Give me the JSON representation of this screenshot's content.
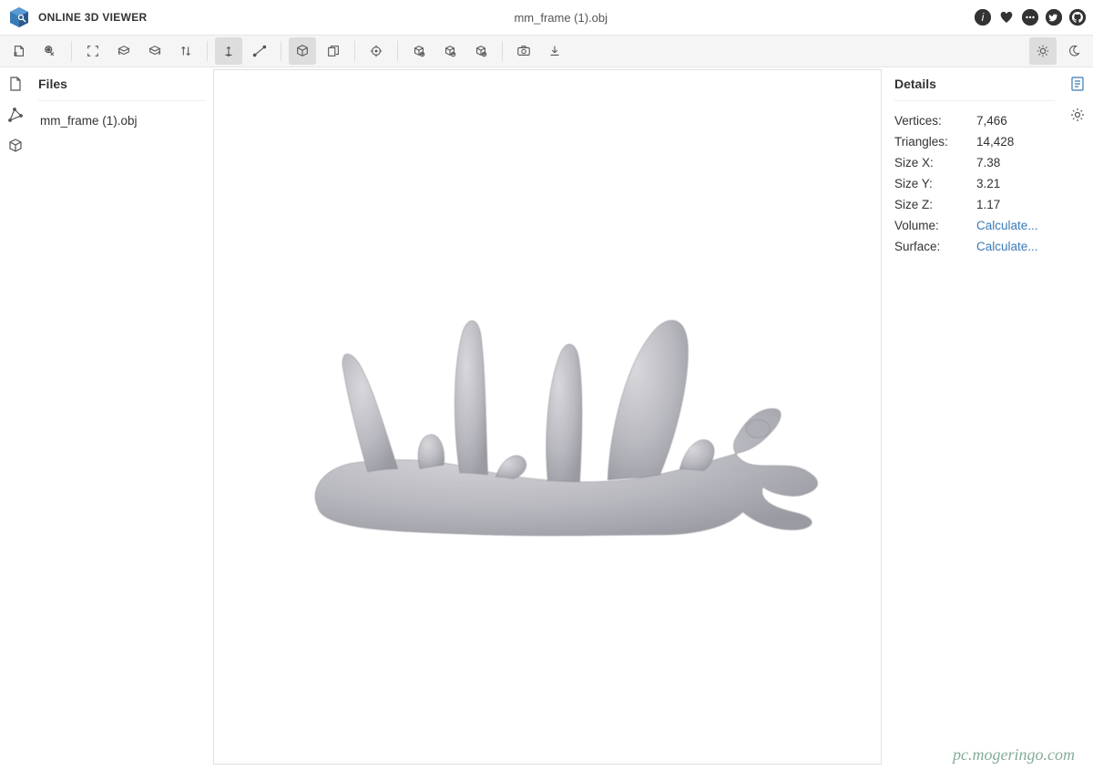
{
  "header": {
    "title": "ONLINE 3D VIEWER",
    "filename": "mm_frame (1).obj"
  },
  "left_panel": {
    "title": "Files",
    "files": [
      "mm_frame (1).obj"
    ]
  },
  "right_panel": {
    "title": "Details",
    "rows": [
      {
        "label": "Vertices:",
        "value": "7,466",
        "link": false
      },
      {
        "label": "Triangles:",
        "value": "14,428",
        "link": false
      },
      {
        "label": "Size X:",
        "value": "7.38",
        "link": false
      },
      {
        "label": "Size Y:",
        "value": "3.21",
        "link": false
      },
      {
        "label": "Size Z:",
        "value": "1.17",
        "link": false
      },
      {
        "label": "Volume:",
        "value": "Calculate...",
        "link": true
      },
      {
        "label": "Surface:",
        "value": "Calculate...",
        "link": true
      }
    ]
  },
  "watermark": "pc.mogeringo.com",
  "toolbar": {
    "groups": [
      [
        "open-file-icon",
        "open-url-icon"
      ],
      [
        "fit-icon",
        "rotate-left-icon",
        "rotate-right-icon",
        "flip-icon"
      ],
      [
        "axis-up-icon",
        "edge-icon"
      ],
      [
        "cube-icon",
        "copy-icon"
      ],
      [
        "measure-icon"
      ],
      [
        "zoom-in-icon",
        "zoom-out-icon",
        "zoom-fit-icon"
      ],
      [
        "camera-icon",
        "download-icon"
      ]
    ],
    "active": [
      "axis-up-icon",
      "cube-icon"
    ],
    "right": [
      "sun-icon",
      "moon-icon"
    ],
    "right_active": [
      "sun-icon"
    ]
  },
  "left_rail": [
    "file-icon",
    "mesh-icon",
    "model-icon"
  ],
  "right_rail": [
    "details-icon",
    "settings-icon"
  ],
  "header_right": [
    "info-icon",
    "heart-icon",
    "comment-icon",
    "twitter-icon",
    "github-icon"
  ]
}
